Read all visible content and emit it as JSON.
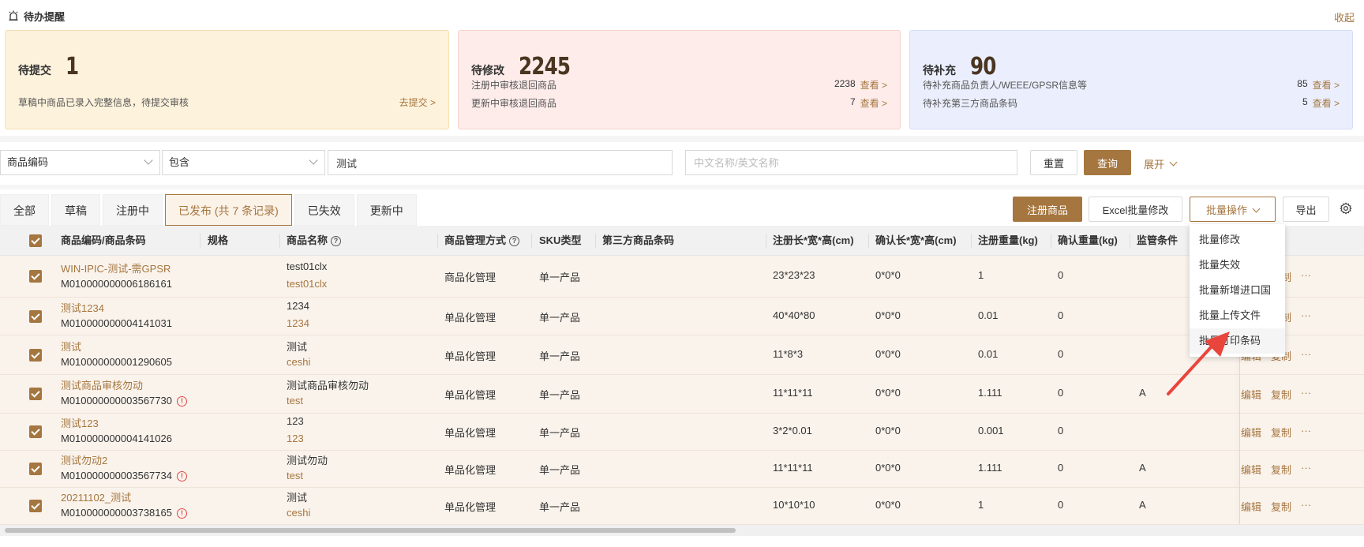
{
  "reminder": {
    "title": "待办提醒",
    "collapse": "收起",
    "cards": [
      {
        "label": "待提交",
        "count": "1",
        "lines": [
          {
            "text": "草稿中商品已录入完整信息，待提交审核",
            "count": "",
            "link": "去提交 >"
          }
        ]
      },
      {
        "label": "待修改",
        "count": "2245",
        "lines": [
          {
            "text": "注册中审核退回商品",
            "count": "2238",
            "link": "查看 >"
          },
          {
            "text": "更新中审核退回商品",
            "count": "7",
            "link": "查看 >"
          }
        ]
      },
      {
        "label": "待补充",
        "count": "90",
        "lines": [
          {
            "text": "待补充商品负责人/WEEE/GPSR信息等",
            "count": "85",
            "link": "查看 >"
          },
          {
            "text": "待补充第三方商品条码",
            "count": "5",
            "link": "查看 >"
          }
        ]
      }
    ]
  },
  "filter": {
    "field": "商品编码",
    "operator": "包含",
    "keyword": "测试",
    "name_placeholder": "中文名称/英文名称",
    "reset": "重置",
    "query": "查询",
    "expand": "展开"
  },
  "tabs": [
    "全部",
    "草稿",
    "注册中",
    "已发布 (共 7 条记录)",
    "已失效",
    "更新中"
  ],
  "toolbar": {
    "register": "注册商品",
    "excel": "Excel批量修改",
    "batch": "批量操作",
    "export": "导出"
  },
  "columns": [
    "商品编码/商品条码",
    "规格",
    "商品名称",
    "商品管理方式",
    "SKU类型",
    "第三方商品条码",
    "注册长*宽*高(cm)",
    "确认长*宽*高(cm)",
    "注册重量(kg)",
    "确认重量(kg)",
    "监管条件"
  ],
  "rows": [
    {
      "code": "WIN-IPIC-测试-需GPSR",
      "barcode": "M010000000006186161",
      "warn": false,
      "name": "test01clx",
      "name_en": "test01clx",
      "mgmt": "商品化管理",
      "sku": "单一产品",
      "reg_dim": "23*23*23",
      "conf_dim": "0*0*0",
      "reg_w": "1",
      "conf_w": "0",
      "reg_cond": ""
    },
    {
      "code": "测试1234",
      "barcode": "M010000000004141031",
      "warn": false,
      "name": "1234",
      "name_en": "1234",
      "mgmt": "单品化管理",
      "sku": "单一产品",
      "reg_dim": "40*40*80",
      "conf_dim": "0*0*0",
      "reg_w": "0.01",
      "conf_w": "0",
      "reg_cond": ""
    },
    {
      "code": "测试",
      "barcode": "M010000000001290605",
      "warn": false,
      "name": "测试",
      "name_en": "ceshi",
      "mgmt": "单品化管理",
      "sku": "单一产品",
      "reg_dim": "11*8*3",
      "conf_dim": "0*0*0",
      "reg_w": "0.01",
      "conf_w": "0",
      "reg_cond": ""
    },
    {
      "code": "测试商品审核勿动",
      "barcode": "M010000000003567730",
      "warn": true,
      "name": "测试商品审核勿动",
      "name_en": "test",
      "mgmt": "单品化管理",
      "sku": "单一产品",
      "reg_dim": "11*11*11",
      "conf_dim": "0*0*0",
      "reg_w": "1.111",
      "conf_w": "0",
      "reg_cond": "A"
    },
    {
      "code": "测试123",
      "barcode": "M010000000004141026",
      "warn": false,
      "name": "123",
      "name_en": "123",
      "mgmt": "单品化管理",
      "sku": "单一产品",
      "reg_dim": "3*2*0.01",
      "conf_dim": "0*0*0",
      "reg_w": "0.001",
      "conf_w": "0",
      "reg_cond": ""
    },
    {
      "code": "测试勿动2",
      "barcode": "M010000000003567734",
      "warn": true,
      "name": "测试勿动",
      "name_en": "test",
      "mgmt": "单品化管理",
      "sku": "单一产品",
      "reg_dim": "11*11*11",
      "conf_dim": "0*0*0",
      "reg_w": "1.111",
      "conf_w": "0",
      "reg_cond": "A"
    },
    {
      "code": "20211102_测试",
      "barcode": "M010000000003738165",
      "warn": true,
      "name": "测试",
      "name_en": "ceshi",
      "mgmt": "单品化管理",
      "sku": "单一产品",
      "reg_dim": "10*10*10",
      "conf_dim": "0*0*0",
      "reg_w": "1",
      "conf_w": "0",
      "reg_cond": "A"
    }
  ],
  "row_ops": {
    "edit": "编辑",
    "copy": "复制",
    "more": "···"
  },
  "batch_menu": [
    "批量修改",
    "批量失效",
    "批量新增进口国",
    "批量上传文件",
    "批量打印条码"
  ],
  "colors": {
    "accent": "#a5763f",
    "warn": "#e04848",
    "annotation": "#e8453c"
  }
}
